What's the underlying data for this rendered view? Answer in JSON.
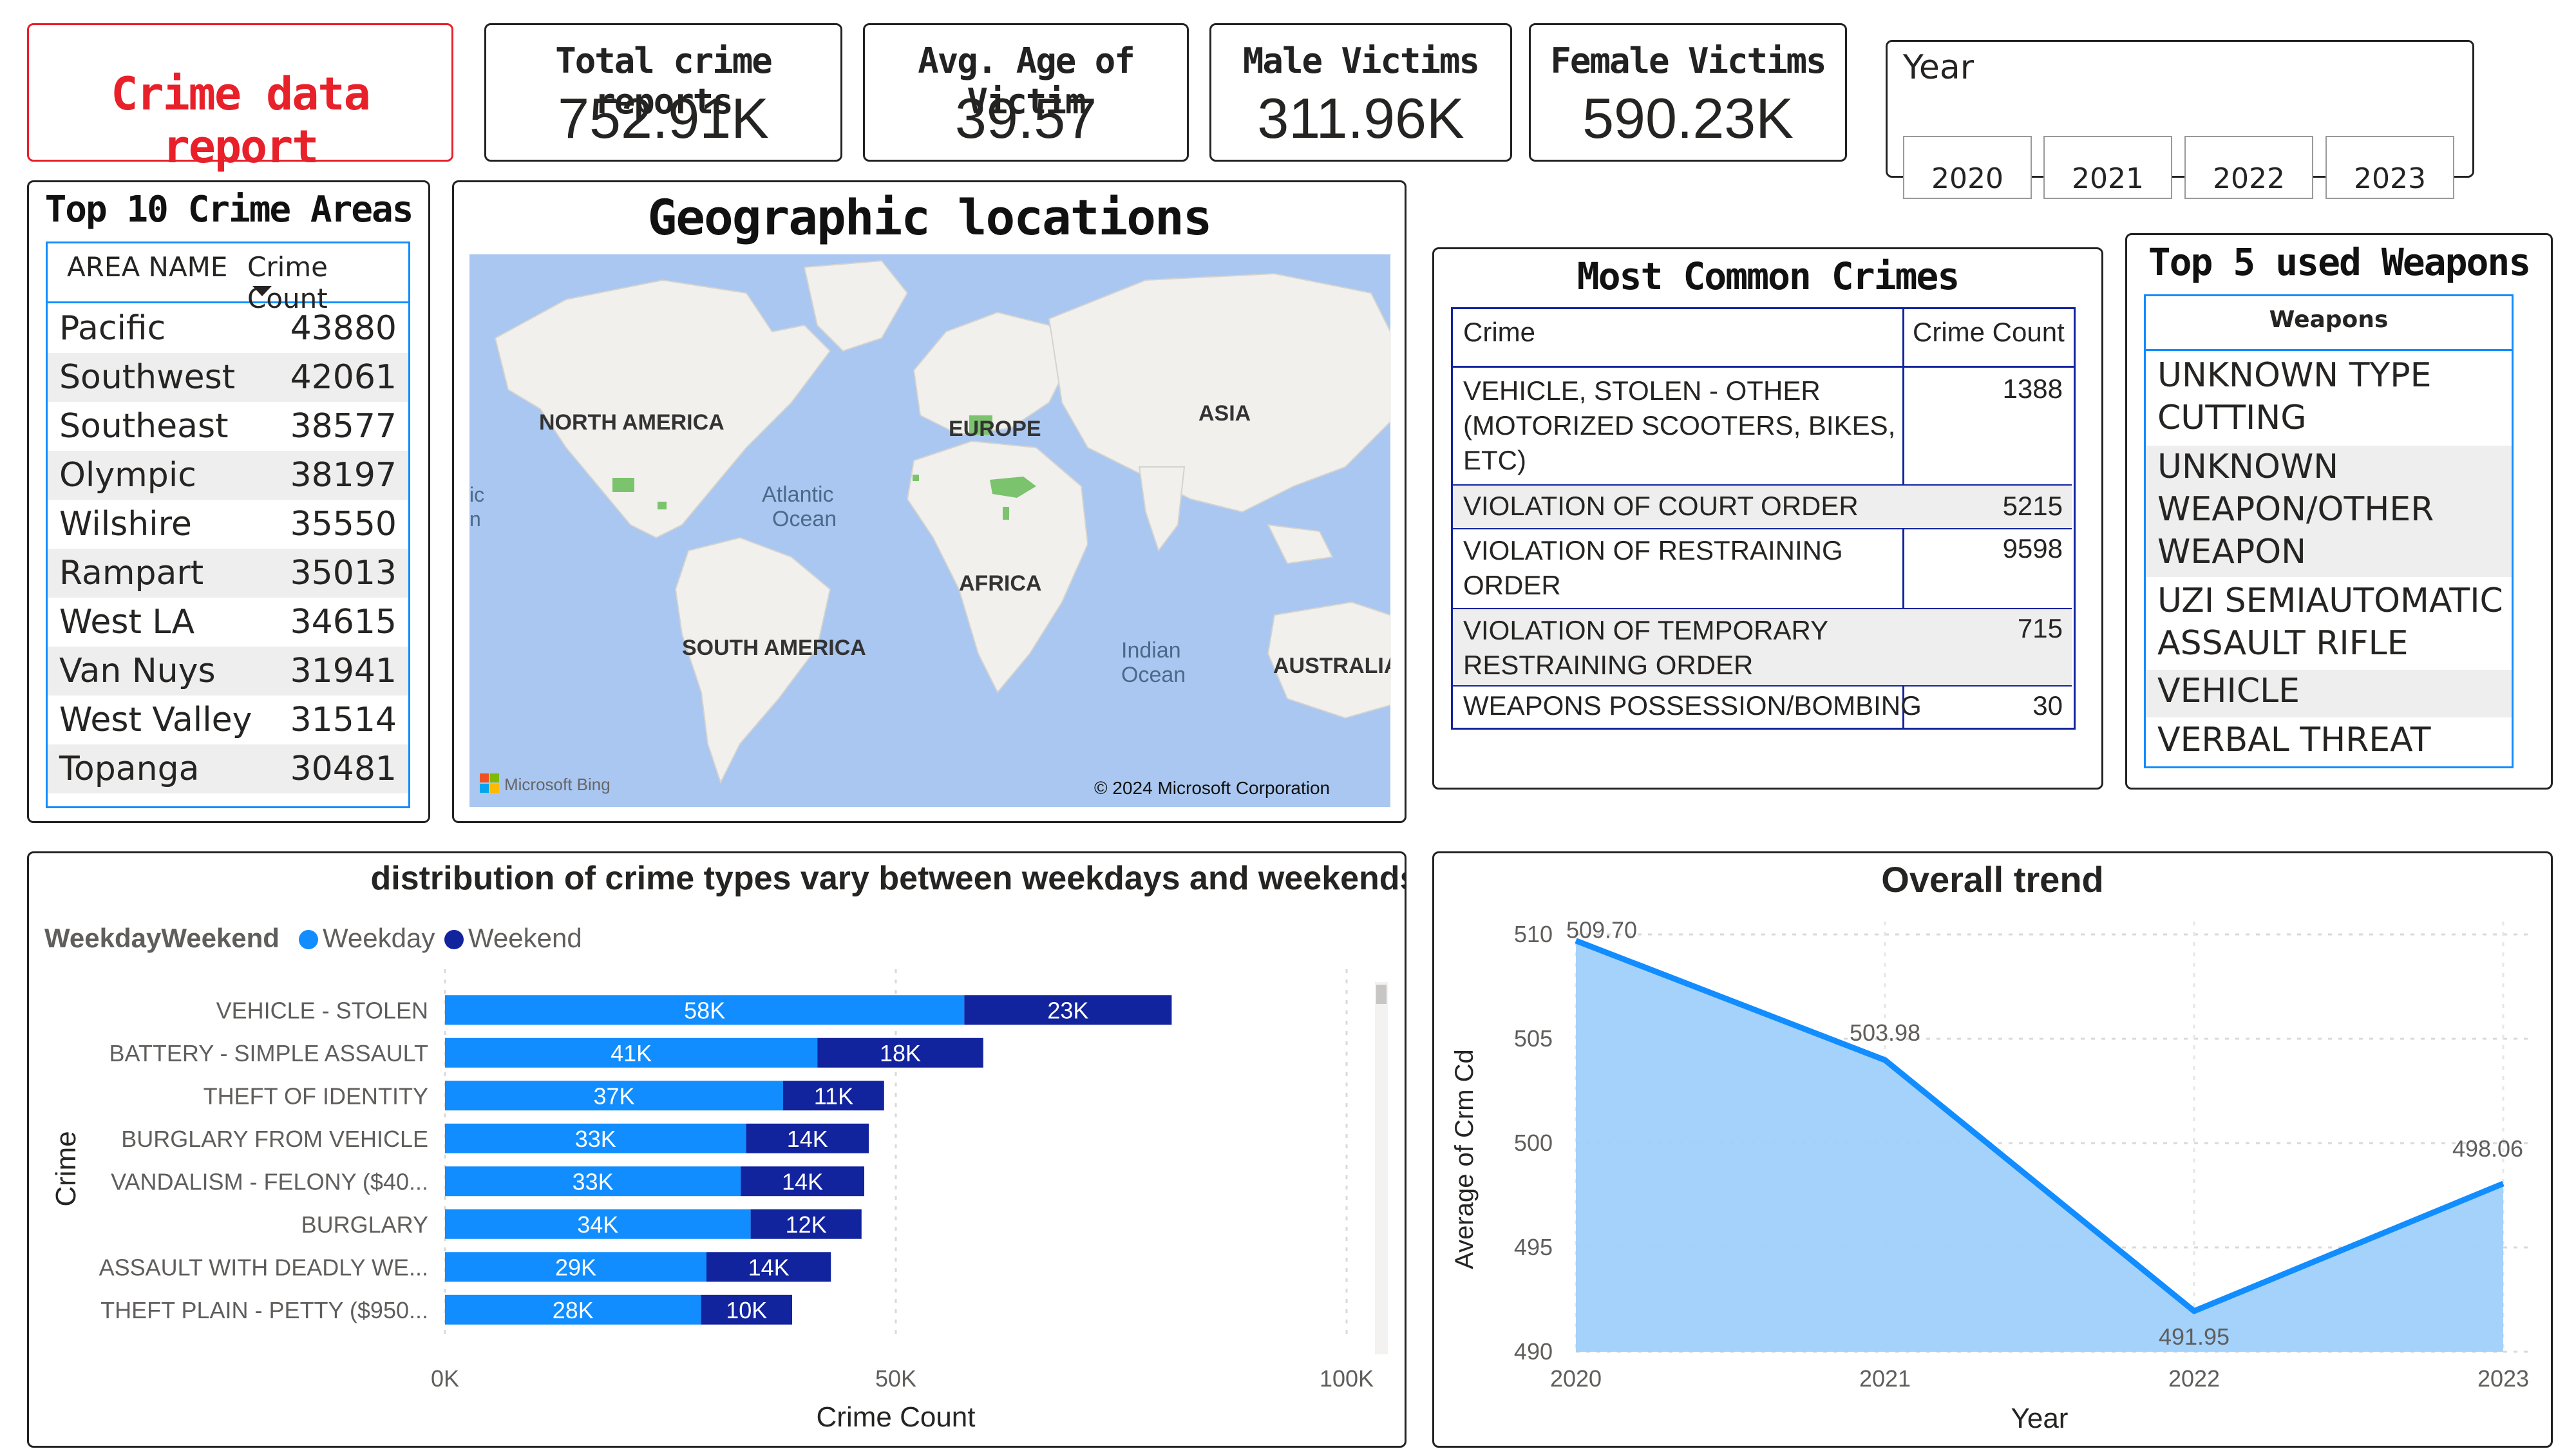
{
  "report_title": "Crime data report",
  "kpis": [
    {
      "label": "Total crime reports",
      "value": "752.91K"
    },
    {
      "label": "Avg. Age of Victim",
      "value": "39.57"
    },
    {
      "label": "Male Victims",
      "value": "311.96K"
    },
    {
      "label": "Female Victims",
      "value": "590.23K"
    }
  ],
  "year_slicer": {
    "label": "Year",
    "options": [
      "2020",
      "2021",
      "2022",
      "2023"
    ]
  },
  "top_areas": {
    "title": "Top 10 Crime Areas",
    "columns": [
      "AREA NAME",
      "Crime Count"
    ],
    "sort_icon": "sort-descending-icon",
    "rows": [
      {
        "name": "Pacific",
        "count": "43880"
      },
      {
        "name": "Southwest",
        "count": "42061"
      },
      {
        "name": "Southeast",
        "count": "38577"
      },
      {
        "name": "Olympic",
        "count": "38197"
      },
      {
        "name": "Wilshire",
        "count": "35550"
      },
      {
        "name": "Rampart",
        "count": "35013"
      },
      {
        "name": "West LA",
        "count": "34615"
      },
      {
        "name": "Van Nuys",
        "count": "31941"
      },
      {
        "name": "West Valley",
        "count": "31514"
      },
      {
        "name": "Topanga",
        "count": "30481"
      }
    ]
  },
  "map": {
    "title": "Geographic locations",
    "labels": {
      "north_america": "NORTH AMERICA",
      "europe": "EUROPE",
      "asia": "ASIA",
      "atlantic": "Atlantic",
      "ocean1": "Ocean",
      "africa": "AFRICA",
      "south_america": "SOUTH AMERICA",
      "indian": "Indian",
      "ocean2": "Ocean",
      "australia": "AUSTRALIA",
      "edge1": "ic",
      "edge2": "n"
    },
    "attribution": "Microsoft Bing",
    "copyright": "© 2024 Microsoft Corporation",
    "colors": {
      "water": "#a9c7f0",
      "land": "#f1f0ed",
      "highlight": "#7cc36e"
    }
  },
  "common_crimes": {
    "title": "Most Common Crimes",
    "columns": [
      "Crime",
      "Crime Count"
    ],
    "rows": [
      {
        "crime": [
          "VEHICLE, STOLEN - OTHER",
          "(MOTORIZED SCOOTERS, BIKES,",
          "ETC)"
        ],
        "count": "1388"
      },
      {
        "crime": [
          "VIOLATION OF COURT ORDER"
        ],
        "count": "5215"
      },
      {
        "crime": [
          "VIOLATION OF RESTRAINING",
          "ORDER"
        ],
        "count": "9598"
      },
      {
        "crime": [
          "VIOLATION OF TEMPORARY",
          "RESTRAINING ORDER"
        ],
        "count": "715"
      },
      {
        "crime": [
          "WEAPONS POSSESSION/BOMBING"
        ],
        "count": "30"
      }
    ]
  },
  "weapons": {
    "title": "Top 5 used Weapons",
    "column": "Weapons",
    "rows": [
      [
        "UNKNOWN TYPE",
        "CUTTING INSTRUMENT"
      ],
      [
        "UNKNOWN",
        "WEAPON/OTHER",
        "WEAPON"
      ],
      [
        "UZI SEMIAUTOMATIC",
        "ASSAULT RIFLE"
      ],
      [
        "VEHICLE"
      ],
      [
        "VERBAL THREAT"
      ]
    ]
  },
  "chart_data": [
    {
      "type": "bar",
      "orientation": "horizontal",
      "stacked": true,
      "title": "distribution of crime types vary between weekdays and weekends",
      "legend_title": "WeekdayWeekend",
      "legend_position": "top-left",
      "xlabel": "Crime Count",
      "ylabel": "Crime",
      "xlim": [
        0,
        100000
      ],
      "x_ticks": [
        "0K",
        "50K",
        "100K"
      ],
      "grid": true,
      "categories": [
        "VEHICLE - STOLEN",
        "BATTERY - SIMPLE ASSAULT",
        "THEFT OF IDENTITY",
        "BURGLARY FROM VEHICLE",
        "VANDALISM - FELONY ($40...",
        "BURGLARY",
        "ASSAULT WITH DEADLY WE...",
        "THEFT PLAIN - PETTY ($950..."
      ],
      "series": [
        {
          "name": "Weekday",
          "color": "#118dff",
          "values": [
            57600,
            41300,
            37500,
            33400,
            32800,
            33900,
            29000,
            28400
          ],
          "labels": [
            "58K",
            "41K",
            "37K",
            "33K",
            "33K",
            "34K",
            "29K",
            "28K"
          ]
        },
        {
          "name": "Weekend",
          "color": "#12239e",
          "values": [
            23000,
            18400,
            11200,
            13600,
            13700,
            12300,
            13800,
            10100
          ],
          "labels": [
            "23K",
            "18K",
            "11K",
            "14K",
            "14K",
            "12K",
            "14K",
            "10K"
          ]
        }
      ]
    },
    {
      "type": "area",
      "title": "Overall trend",
      "xlabel": "Year",
      "ylabel": "Average of Crm Cd",
      "x": [
        2020,
        2021,
        2022,
        2023
      ],
      "ylim": [
        490,
        510
      ],
      "y_ticks": [
        490,
        495,
        500,
        505,
        510
      ],
      "grid": true,
      "series": [
        {
          "values": [
            509.7,
            503.98,
            491.95,
            498.06
          ],
          "labels": [
            "509.70",
            "503.98",
            "491.95",
            "498.06"
          ],
          "color": "#118dff",
          "fill": "#9fd0fb"
        }
      ]
    }
  ]
}
